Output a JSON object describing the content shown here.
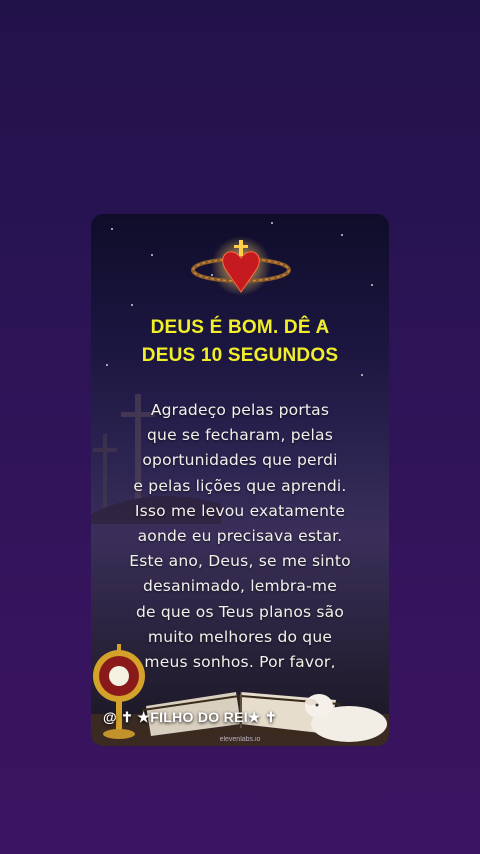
{
  "post": {
    "title_line1": "DEUS É BOM. DÊ A",
    "title_line2": "DEUS 10 SEGUNDOS",
    "body_lines": [
      "Agradeço pelas portas",
      "que se fecharam, pelas",
      "oportunidades que perdi",
      "e pelas lições que aprendi.",
      "Isso me levou exatamente",
      "aonde eu precisava estar.",
      "Este ano, Deus, se me sinto",
      "desanimado, lembra-me",
      "de que os Teus planos são",
      "muito melhores do que",
      "meus sonhos. Por favor,"
    ],
    "footer_label": "@ ✝ ★FILHO DO REI★ ✝",
    "watermark": "elevenlabs.io"
  },
  "colors": {
    "title": "#f2ef2a",
    "background": "#2c1456",
    "text": "#f4f1ec"
  },
  "icons": [
    "crown-of-thorns-heart-icon",
    "monstrance-icon",
    "open-bible-icon",
    "lamb-icon",
    "cross-icon"
  ]
}
